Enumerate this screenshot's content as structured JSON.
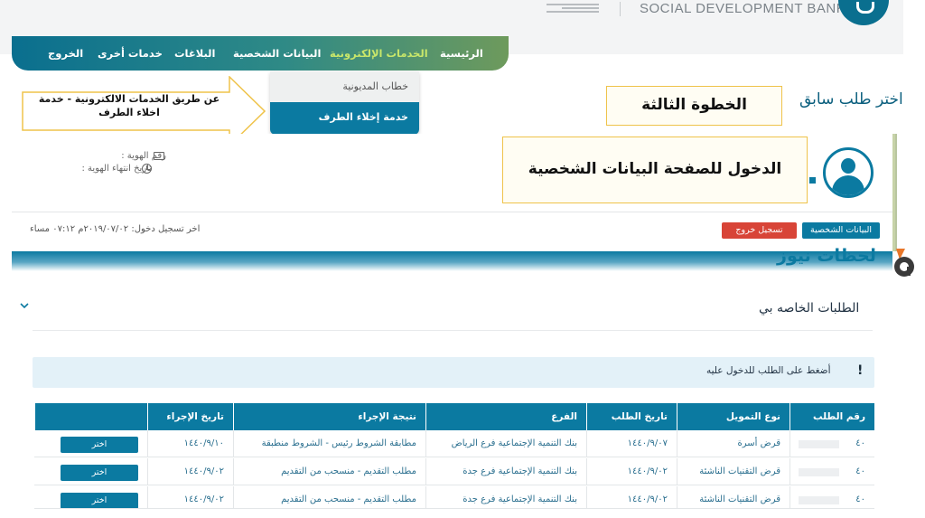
{
  "brand": {
    "name": "SOCIAL DEVELOPMENT BANK"
  },
  "nav": {
    "items": [
      {
        "label": "الرئيسية",
        "active": false
      },
      {
        "label": "الخدمات الإلكترونية",
        "active": true
      },
      {
        "label": "البيانات الشخصية",
        "active": false
      },
      {
        "label": "البلاغات",
        "active": false
      },
      {
        "label": "خدمات أخرى",
        "active": false
      },
      {
        "label": "الخروج",
        "active": false
      }
    ]
  },
  "dropdown": {
    "items": [
      {
        "label": "خطاب المديونية"
      },
      {
        "label": "خدمة إخلاء الطرف",
        "selected": true
      }
    ]
  },
  "annotations": {
    "callout": "عن طريق الخدمات الالكترونية - خدمة اخلاء الطرف",
    "step3": "الخطوة الثالثة",
    "step_personal": "الدخول للصفحة البيانات الشخصية"
  },
  "page": {
    "previous_request": "اختر طلب سابق"
  },
  "profile": {
    "id_label": "رقم الهوية :",
    "id_expiry_label": "تاريخ انتهاء الهوية :",
    "personal_button": "البيانات الشخصية",
    "logout_button": "تسجيل خروج",
    "last_login": "اخر تسجيل دخول: ٢٠١٩/٠٧/٠٢م ٠٧:١٢ مساء"
  },
  "watermark": "لحظات نيوز",
  "requests": {
    "title": "الطلبات الخاصه بي",
    "info": "أضغط على الطلب للدخول عليه",
    "columns": [
      "رقم الطلب",
      "نوع التمويل",
      "تاريخ الطلب",
      "الفرع",
      "نتيجة الإجراء",
      "تاريخ الإجراء",
      ""
    ],
    "rows": [
      {
        "id": "٤٠",
        "type": "قرض أسرة",
        "date": "١٤٤٠/٩/٠٧",
        "branch": "بنك التنمية الإجتماعية فرع الرياض",
        "result": "مطابقة الشروط رئيس - الشروط منطبقة",
        "action_date": "١٤٤٠/٩/١٠",
        "button": "اختر"
      },
      {
        "id": "٤٠",
        "type": "قرض التقنيات الناشئة",
        "date": "١٤٤٠/٩/٠٢",
        "branch": "بنك التنمية الإجتماعية فرع جدة",
        "result": "مطلب التقديم - منسحب من التقديم",
        "action_date": "١٤٤٠/٩/٠٢",
        "button": "اختر"
      },
      {
        "id": "٤٠",
        "type": "قرض التقنيات الناشئة",
        "date": "١٤٤٠/٩/٠٢",
        "branch": "بنك التنمية الإجتماعية فرع جدة",
        "result": "مطلب التقديم - منسحب من التقديم",
        "action_date": "١٤٤٠/٩/٠٢",
        "button": "اختر"
      }
    ]
  },
  "colors": {
    "primary": "#0b7aa1",
    "nav_active": "#c8e66a",
    "logout": "#d84437",
    "callout_border": "#efc34a"
  }
}
